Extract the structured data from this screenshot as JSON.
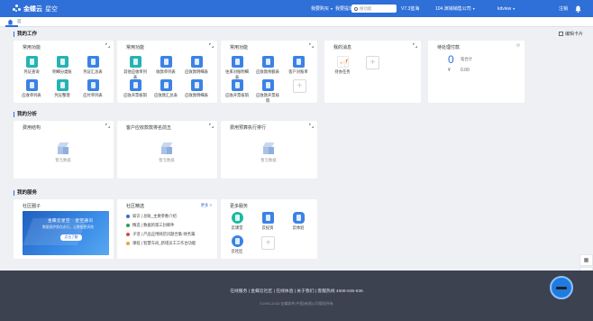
{
  "topbar": {
    "brand": "金蝶云",
    "brand_sub": "星空",
    "nav_buy": "我要购买",
    "nav_order": "我要提单",
    "search_placeholder": "搜功能",
    "version": "V7.3蓝海",
    "company": "104.演销销售公司",
    "user": "kdview",
    "logout": "注销"
  },
  "tabs": {
    "home_icon": "home-icon",
    "tab_label": "首"
  },
  "sections": {
    "work": "我的工作",
    "analysis": "我的分析",
    "service": "我的服务",
    "edit_card": "编辑卡片"
  },
  "work_cards": [
    {
      "title": "常用功能",
      "apps": [
        {
          "label": "凭证查询",
          "color": "teal"
        },
        {
          "label": "明细分类账",
          "color": "teal"
        },
        {
          "label": "凭证汇总表",
          "color": "blue"
        },
        {
          "label": "应收单列表",
          "color": "blue"
        },
        {
          "label": "凭证整理",
          "color": "teal"
        },
        {
          "label": "应付单列表",
          "color": "blue"
        }
      ]
    },
    {
      "title": "常用功能",
      "apps": [
        {
          "label": "其他应收单列表",
          "color": "teal"
        },
        {
          "label": "收款单列表",
          "color": "blue"
        },
        {
          "label": "应收款明细表",
          "color": "blue"
        },
        {
          "label": "应收开票核销",
          "color": "blue"
        },
        {
          "label": "应收款汇总表",
          "color": "blue"
        },
        {
          "label": "应收款明细表",
          "color": "blue"
        }
      ]
    },
    {
      "title": "常用功能",
      "apps": [
        {
          "label": "往来对账明细表",
          "color": "blue"
        },
        {
          "label": "应收款余额表",
          "color": "blue"
        },
        {
          "label": "客户对账单",
          "color": "blue"
        },
        {
          "label": "应收开票核销",
          "color": "blue"
        },
        {
          "label": "应收款开票核销",
          "color": "blue"
        }
      ]
    }
  ],
  "messages": {
    "title": "我的消息",
    "item_label": "待办任务"
  },
  "todo": {
    "title": "待处理付款",
    "count": "0",
    "count_label": "笔合计",
    "amount": "¥",
    "amount_value": "0.00"
  },
  "analysis_cards": [
    {
      "title": "费用结构",
      "empty": "暂无数据"
    },
    {
      "title": "客户应收款款排名前五",
      "empty": "暂无数据"
    },
    {
      "title": "费用预算执行排行",
      "empty": "暂无数据"
    }
  ],
  "community": {
    "title": "社区圈子",
    "banner_text": "金蝶云星空 · 星空通讯",
    "banner_sub": "数据保护势在必行，让数据更高效",
    "banner_btn": "点击了解"
  },
  "featured": {
    "title": "社区精选",
    "more": "更多 >",
    "items": [
      {
        "text": "知识 | 总账_主要参数介绍",
        "color": "#2f6fd8"
      },
      {
        "text": "精选 | 数据的第三封邮件",
        "color": "#2f9f5b"
      },
      {
        "text": "子话 | 产品应用网店问题合集-财务篇",
        "color": "#e04848"
      },
      {
        "text": "课程 | 智慧车间_新增员工工作台功能",
        "color": "#f2a13a"
      }
    ]
  },
  "more_services": {
    "title": "更多服务",
    "apps": [
      {
        "label": "云课堂",
        "color": "#1fb8a0"
      },
      {
        "label": "云投资",
        "color": "#3b82e6"
      },
      {
        "label": "云体验",
        "color": "#3b82e6"
      },
      {
        "label": "云社区",
        "color": "#3b82e6"
      }
    ]
  },
  "footer": {
    "links": "在线服务 | 金蝶云社区 | 在线体验 | 关于我们 | 客服热线 4008-836-836",
    "copyright": "©1993-2018 金蝶软件(中国)有限公司版权所有"
  }
}
